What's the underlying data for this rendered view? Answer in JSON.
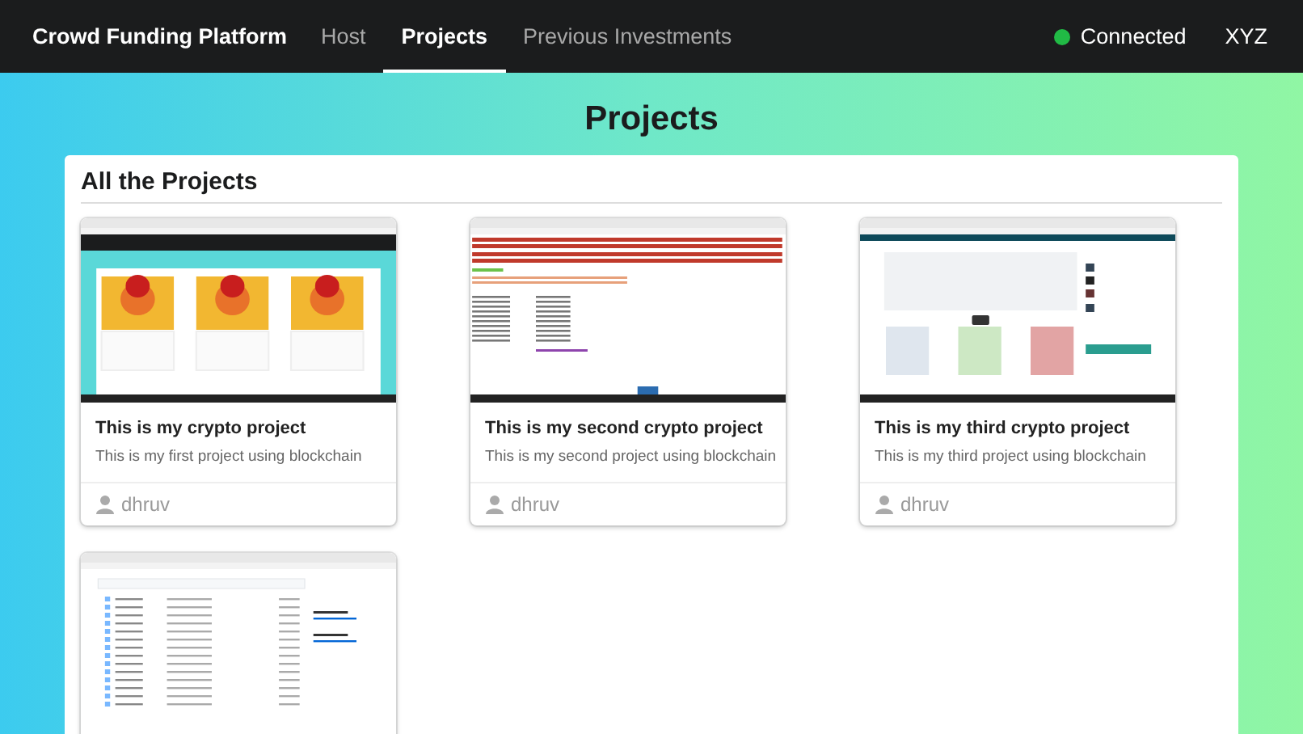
{
  "navbar": {
    "brand": "Crowd Funding Platform",
    "items": [
      {
        "label": "Host",
        "selected": false
      },
      {
        "label": "Projects",
        "selected": true
      },
      {
        "label": "Previous Investments",
        "selected": false
      }
    ],
    "status": {
      "label": "Connected",
      "connected": true
    },
    "user": "XYZ"
  },
  "page_title": "Projects",
  "panel": {
    "title": "All the Projects",
    "cards": [
      {
        "kind": "app",
        "title": "This is my crypto project",
        "description": "This is my first project using blockchain",
        "author": "dhruv"
      },
      {
        "kind": "receipt",
        "title": "This is my second crypto project",
        "description": "This is my second project using blockchain",
        "author": "dhruv"
      },
      {
        "kind": "video",
        "title": "This is my third crypto project",
        "description": "This is my third project using blockchain",
        "author": "dhruv"
      },
      {
        "kind": "repo"
      }
    ]
  }
}
